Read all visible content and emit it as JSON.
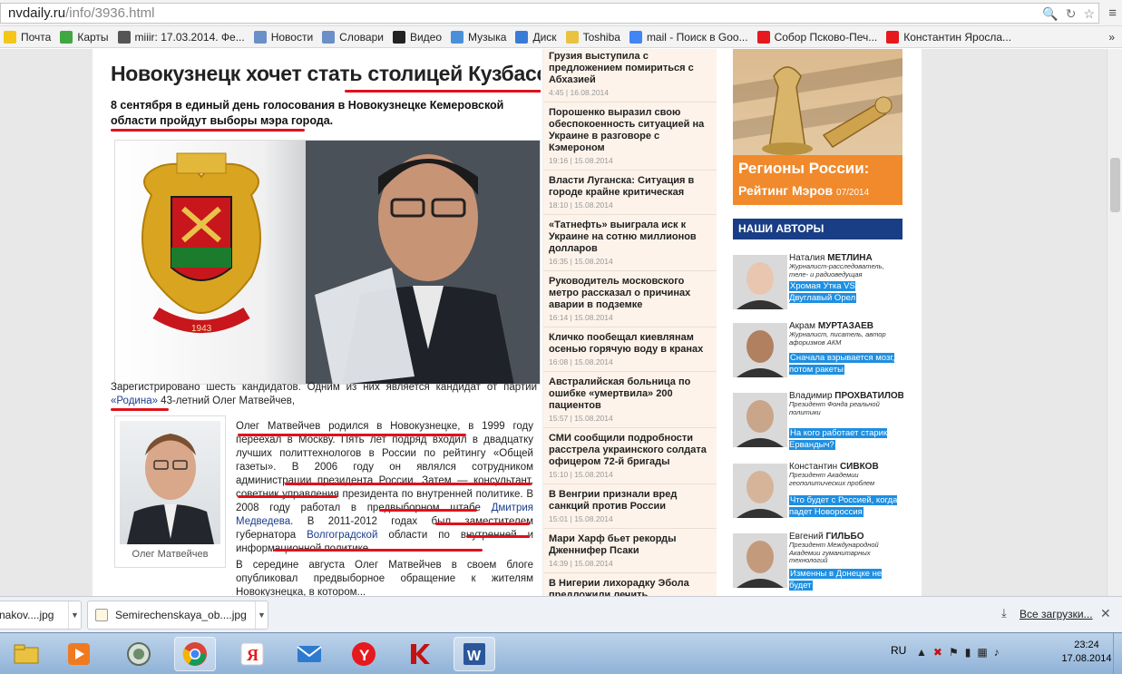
{
  "browser": {
    "url_host": "nvdaily.ru",
    "url_path": "/info/3936.html"
  },
  "bookmarks": [
    {
      "label": "Почта",
      "icon": "mail-icon"
    },
    {
      "label": "Карты",
      "icon": "maps-icon"
    },
    {
      "label": "miiir: 17.03.2014. Фе...",
      "icon": "user-icon"
    },
    {
      "label": "Новости",
      "icon": "page-icon"
    },
    {
      "label": "Словари",
      "icon": "page-icon"
    },
    {
      "label": "Видео",
      "icon": "video-icon"
    },
    {
      "label": "Музыка",
      "icon": "music-icon"
    },
    {
      "label": "Диск",
      "icon": "disk-icon"
    },
    {
      "label": "Toshiba",
      "icon": "folder-icon"
    },
    {
      "label": "mail - Поиск в Goo...",
      "icon": "google-icon"
    },
    {
      "label": "Собор Псково-Печ...",
      "icon": "yandex-icon"
    },
    {
      "label": "Константин Яросла...",
      "icon": "yandex-icon"
    }
  ],
  "bookmarks_more": "»",
  "article": {
    "title": "Новокузнецк хочет стать столицей Кузбасса",
    "lead": "8 сентября в единый день голосования в Новокузнецке Кемеровской области пройдут выборы мэра города.",
    "coat_year": "1943",
    "p1": "Зарегистрировано шесть кандидатов. Одним из них является кандидат от партии",
    "p1_link": "«Родина»",
    "p1_tail": " 43-летний Олег Матвейчев,",
    "inset_caption": "Олег Матвейчев",
    "p2": "Олег Матвейчев родился в Новокузнецке, в 1999 году переехал в Москву. Пять лет подряд входил в двадцатку лучших политтехнологов в России по рейтингу «Общей газеты». В 2006 году он являлся сотрудником администрации президента России. Затем — консультант, советник управления президента по внутренней политике. В 2008 году работал в предвыборном штабе ",
    "p2_link1": "Дмитрия Медведева",
    "p2_mid": ". В 2011-2012 годах был заместителем губернатора ",
    "p2_link2": "Волгоградской",
    "p2_tail": " области по внутренней и информационной политике.",
    "p3": "В середине августа Олег Матвейчев в своем блоге опубликовал предвыборное обращение к жителям Новокузнецка, в котором..."
  },
  "news": [
    {
      "title": "Грузия выступила с предложением помириться с Абхазией",
      "meta": "4:45 | 16.08.2014"
    },
    {
      "title": "Порошенко выразил свою обеспокоенность ситуацией на Украине в разговоре с Кэмероном",
      "meta": "19:16 | 15.08.2014"
    },
    {
      "title": "Власти Луганска: Ситуация в городе крайне критическая",
      "meta": "18:10 | 15.08.2014"
    },
    {
      "title": "«Татнефть» выиграла иск к Украине на сотню миллионов долларов",
      "meta": "16:35 | 15.08.2014"
    },
    {
      "title": "Руководитель московского метро рассказал о причинах аварии в подземке",
      "meta": "16:14 | 15.08.2014"
    },
    {
      "title": "Кличко пообещал киевлянам осенью горячую воду в кранах",
      "meta": "16:08 | 15.08.2014"
    },
    {
      "title": "Австралийская больница по ошибке «умертвила» 200 пациентов",
      "meta": "15:57 | 15.08.2014"
    },
    {
      "title": "СМИ сообщили подробности расстрела украинского солдата офицером 72-й бригады",
      "meta": "15:10 | 15.08.2014"
    },
    {
      "title": "В Венгрии признали вред санкций против России",
      "meta": "15:01 | 15.08.2014"
    },
    {
      "title": "Мари Харф бьет рекорды Дженнифер Псаки",
      "meta": "14:39 | 15.08.2014"
    },
    {
      "title": "В Нигерии лихорадку Эбола предложили лечить «наносеребром»",
      "meta": ""
    }
  ],
  "ad": {
    "line1": "Регионы России:",
    "line2": "Рейтинг Мэров",
    "date": "07/2014"
  },
  "authors_header": "НАШИ АВТОРЫ",
  "authors": [
    {
      "first": "Наталия",
      "last": "МЕТЛИНА",
      "role": "Журналист-расследователь, теле- и радиоведущая",
      "post": "Хромая Утка VS Двуглавый Орел"
    },
    {
      "first": "Акрам",
      "last": "МУРТАЗАЕВ",
      "role": "Журналист, писатель, автор афоризмов АКМ",
      "post": "Сначала взрывается мозг, потом ракеты"
    },
    {
      "first": "Владимир",
      "last": "ПРОХВАТИЛОВ",
      "role": "Президент Фонда реальной политики",
      "post": "На кого работает старик Ервандыч?"
    },
    {
      "first": "Константин",
      "last": "СИВКОВ",
      "role": "Президент Академии геополитических проблем",
      "post": "Что будет с Россией, когда падет Новороссия"
    },
    {
      "first": "Евгений",
      "last": "ГИЛЬБО",
      "role": "Президент Международной Академии гуманитарных технологий",
      "post": "Изменны в Донецке не будет"
    }
  ],
  "downloads": [
    {
      "label": "nakov....jpg"
    },
    {
      "label": "Semirechenskaya_ob....jpg"
    }
  ],
  "downloads_all": "Все загрузки...",
  "taskbar": {
    "lang": "RU",
    "time": "23:24",
    "date": "17.08.2014"
  }
}
